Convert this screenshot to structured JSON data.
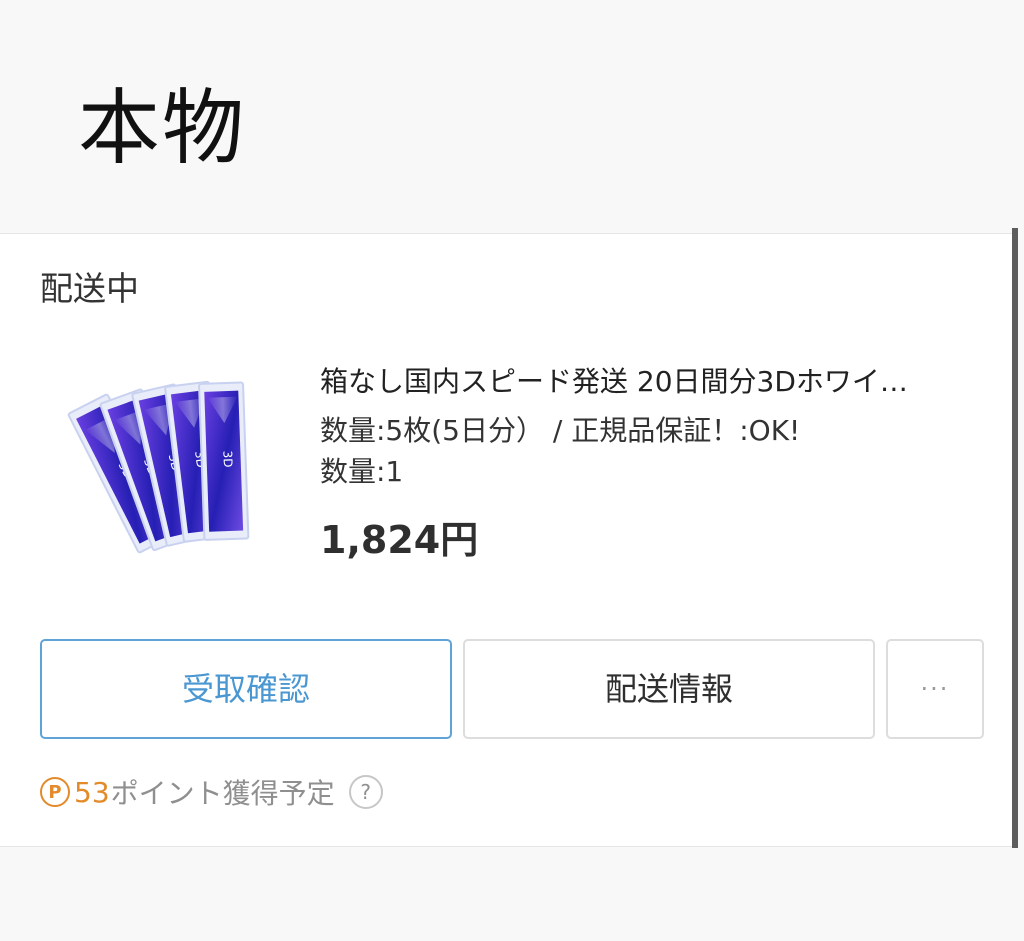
{
  "headline": "本物",
  "order": {
    "status": "配送中",
    "product": {
      "title": "箱なし国内スピード発送 20日間分3Dホワイ…",
      "variant": "数量:5枚(5日分） / 正規品保証！:OK!",
      "quantity": "数量:1",
      "price": "1,824円"
    },
    "actions": {
      "confirm_label": "受取確認",
      "shipping_label": "配送情報",
      "more_label": "···"
    },
    "points": {
      "badge": "P",
      "value": "53",
      "label": "ポイント獲得予定",
      "help_icon": "?"
    }
  },
  "colors": {
    "accent": "#4a97d1",
    "points": "#e38a2a"
  }
}
